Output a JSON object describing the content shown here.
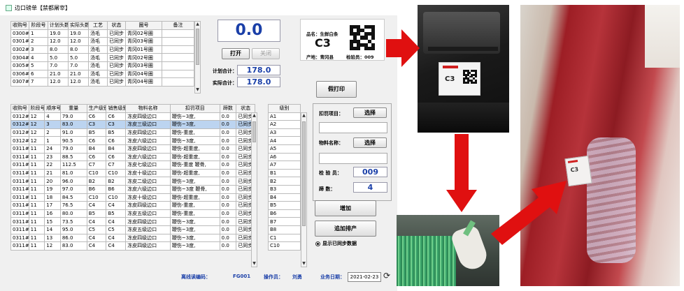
{
  "window": {
    "title": "边口磅单【禁都屠宰】"
  },
  "table1": {
    "headers": [
      "收购号",
      "阶段号",
      "计划头数",
      "实际头数",
      "工艺",
      "状态",
      "圈号",
      "备注"
    ],
    "rows": [
      [
        "0300#",
        "1",
        "19.0",
        "19.0",
        "汤毛",
        "已同步",
        "青冈02号圈",
        ""
      ],
      [
        "0301#",
        "2",
        "12.0",
        "12.0",
        "汤毛",
        "已同步",
        "青冈03号圈",
        ""
      ],
      [
        "0302#",
        "3",
        "8.0",
        "8.0",
        "汤毛",
        "已同步",
        "青冈01号圈",
        ""
      ],
      [
        "0304#",
        "4",
        "5.0",
        "5.0",
        "汤毛",
        "已同步",
        "青冈02号圈",
        ""
      ],
      [
        "0305#",
        "5",
        "7.0",
        "7.0",
        "汤毛",
        "已同步",
        "青冈03号圈",
        ""
      ],
      [
        "0306#",
        "6",
        "21.0",
        "21.0",
        "汤毛",
        "已同步",
        "青冈04号圈",
        ""
      ],
      [
        "0307#",
        "7",
        "12.0",
        "12.0",
        "汤毛",
        "已同步",
        "青冈04号圈",
        ""
      ]
    ]
  },
  "display": {
    "big_value": "0.0",
    "open_btn": "打开",
    "close_btn": "关闭"
  },
  "totals": {
    "plan_label": "计划合计：",
    "plan_value": "178.0",
    "actual_label": "实际合计：",
    "actual_value": "178.0"
  },
  "label_preview": {
    "name": "品名：生鲜白条",
    "grade": "C3",
    "origin": "产地：青冈县",
    "inspector": "检验员：009"
  },
  "fake_print_btn": "假打印",
  "table2": {
    "headers": [
      "收购号",
      "阶段号",
      "顺序号",
      "重量",
      "生产级别",
      "销售级别",
      "物料名称",
      "扣罚项目",
      "蹄数",
      "状态"
    ],
    "rows": [
      [
        "0312#",
        "12",
        "4",
        "79.0",
        "C6",
        "C6",
        "冻皮四级边口",
        "鞭伤~3度,",
        "0.0",
        "已同步"
      ],
      [
        "0312#",
        "12",
        "3",
        "83.0",
        "C3",
        "C3",
        "冻皮三级边口",
        "鞭伤~3度,",
        "0.0",
        "已同步"
      ],
      [
        "0312#",
        "12",
        "2",
        "91.0",
        "B5",
        "B5",
        "冻皮四级边口",
        "鞭伤-重度,",
        "0.0",
        "已同步"
      ],
      [
        "0312#",
        "12",
        "1",
        "90.5",
        "C6",
        "C6",
        "冻皮六级边口",
        "鞭伤~3度,",
        "0.0",
        "已同步"
      ],
      [
        "0311#",
        "11",
        "24",
        "79.0",
        "B4",
        "B4",
        "冻皮四级边口",
        "鞭伤-超重度,",
        "0.0",
        "已同步"
      ],
      [
        "0311#",
        "11",
        "23",
        "88.5",
        "C6",
        "C6",
        "冻皮六级边口",
        "鞭伤-超重度,",
        "0.0",
        "已同步"
      ],
      [
        "0311#",
        "11",
        "22",
        "112.5",
        "C7",
        "C7",
        "冻皮七级边口",
        "鞭伤-重度 鞭骨,",
        "0.0",
        "已同步"
      ],
      [
        "0311#",
        "11",
        "21",
        "81.0",
        "C10",
        "C10",
        "冻皮十级边口",
        "鞭伤-超重度,",
        "0.0",
        "已同步"
      ],
      [
        "0311#",
        "11",
        "20",
        "96.0",
        "B2",
        "B2",
        "冻皮二级边口",
        "鞭伤~3度,",
        "0.0",
        "已同步"
      ],
      [
        "0311#",
        "11",
        "19",
        "97.0",
        "B6",
        "B6",
        "冻皮六级边口",
        "鞭伤~3度 鞭骨,",
        "0.0",
        "已同步"
      ],
      [
        "0311#",
        "11",
        "18",
        "84.5",
        "C10",
        "C10",
        "冻皮十级边口",
        "鞭伤-超重度,",
        "0.0",
        "已同步"
      ],
      [
        "0311#",
        "11",
        "17",
        "76.5",
        "C4",
        "C4",
        "冻皮四级边口",
        "鞭伤-重度,",
        "0.0",
        "已同步"
      ],
      [
        "0311#",
        "11",
        "16",
        "80.0",
        "B5",
        "B5",
        "冻皮五级边口",
        "鞭伤-重度,",
        "0.0",
        "已同步"
      ],
      [
        "0311#",
        "11",
        "15",
        "73.5",
        "C4",
        "C4",
        "冻皮四级边口",
        "鞭伤~3度,",
        "0.0",
        "已同步"
      ],
      [
        "0311#",
        "11",
        "14",
        "95.0",
        "C5",
        "C5",
        "冻皮五级边口",
        "鞭伤~3度,",
        "0.0",
        "已同步"
      ],
      [
        "0311#",
        "11",
        "13",
        "86.0",
        "C4",
        "C4",
        "冻皮四级边口",
        "鞭伤~3度,",
        "0.0",
        "已同步"
      ],
      [
        "0311#",
        "11",
        "12",
        "83.0",
        "C4",
        "C4",
        "冻皮四级边口",
        "鞭伤~3度,",
        "0.0",
        "已同步"
      ]
    ]
  },
  "grades": {
    "header": "级别",
    "items": [
      "A1",
      "A2",
      "A3",
      "A4",
      "A5",
      "A6",
      "A7",
      "B1",
      "B2",
      "B3",
      "B4",
      "B5",
      "B6",
      "B7",
      "B8",
      "C1",
      "C10"
    ]
  },
  "form": {
    "deduct_label": "扣罚项目：",
    "material_label": "物料名称：",
    "select_btn": "选择",
    "inspector_label": "检 验 员：",
    "inspector_value": "009",
    "hoof_label": "蹄     数：",
    "hoof_value": "4",
    "add_btn": "增加",
    "append_btn": "追加排产",
    "radio_label": "显示已同步数据"
  },
  "status_bar": {
    "line_label": "离线读编码：",
    "line_value": "FG001",
    "operator_label": "操作员：",
    "operator_value": "刘勇",
    "date_label": "业务日期：",
    "date_value": "2021-02-23"
  },
  "photos": {
    "printer_tag_grade": "C3",
    "carcass_tag_grade": "C3"
  },
  "colors": {
    "arrow": "#e01010",
    "value_blue": "#1a3fa8"
  }
}
